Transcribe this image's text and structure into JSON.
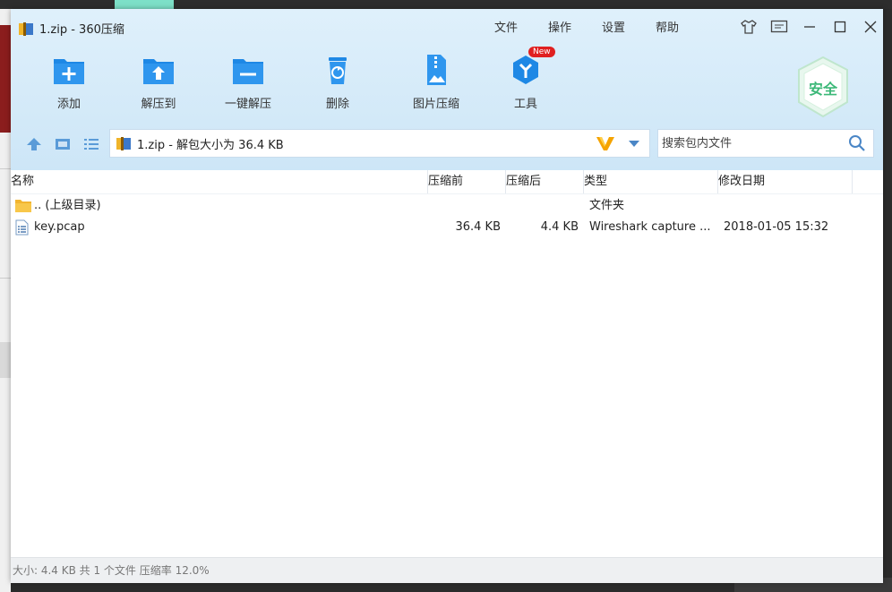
{
  "app": {
    "title": "1.zip - 360压缩"
  },
  "menu": {
    "items": [
      "文件",
      "操作",
      "设置",
      "帮助"
    ]
  },
  "toolbar": {
    "add": "添加",
    "extract_to": "解压到",
    "one_click_extract": "一键解压",
    "delete": "删除",
    "image_compress": "图片压缩",
    "tools": "工具",
    "tools_badge": "New"
  },
  "security": {
    "label": "安全"
  },
  "address": {
    "path": "1.zip - 解包大小为 36.4 KB"
  },
  "search": {
    "placeholder": "搜索包内文件"
  },
  "columns": {
    "name": "名称",
    "packed_size_before": "压缩前",
    "packed_size_after": "压缩后",
    "type": "类型",
    "modified": "修改日期"
  },
  "files": [
    {
      "name": ".. (上级目录)",
      "size_before": "",
      "size_after": "",
      "type": "文件夹",
      "modified": ""
    },
    {
      "name": "key.pcap",
      "size_before": "36.4 KB",
      "size_after": "4.4 KB",
      "type": "Wireshark capture ...",
      "modified": "2018-01-05 15:32"
    }
  ],
  "status": {
    "text": "大小: 4.4 KB 共 1 个文件 压缩率 12.0%"
  },
  "colors": {
    "accent": "#1e88e5",
    "header_bg": "#d6ebf8",
    "badge": "#e02020",
    "shield": "#3cb878",
    "v_logo": "#f5a300"
  }
}
